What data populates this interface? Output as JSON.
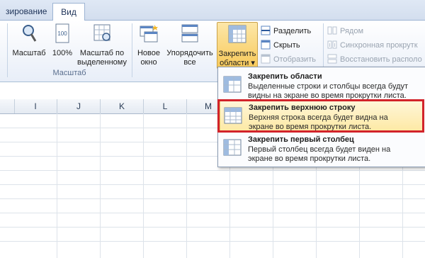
{
  "tabs": [
    {
      "label": "зирование"
    },
    {
      "label": "Вид"
    }
  ],
  "ribbon": {
    "zoom_button": "Масштаб",
    "zoom100_button": "100%",
    "zoom_selection_line1": "Масштаб по",
    "zoom_selection_line2": "выделенному",
    "zoom_group_label": "Масштаб",
    "new_window_line1": "Новое",
    "new_window_line2": "окно",
    "arrange_line1": "Упорядочить",
    "arrange_line2": "все",
    "freeze_line1": "Закрепить",
    "freeze_line2": "области",
    "freeze_arrow": "▾",
    "split": "Разделить",
    "hide": "Скрыть",
    "unhide": "Отобразить",
    "side_by_side": "Рядом",
    "sync_scroll": "Синхронная прокрутк",
    "reset_position": "Восстановить располо"
  },
  "columns": [
    "I",
    "J",
    "K",
    "L",
    "M"
  ],
  "freeze_menu": {
    "items": [
      {
        "title": "Закрепить области",
        "desc_line1": "Выделенные строки и столбцы всегда будут",
        "desc_line2": "видны на экране во время прокрутки листа."
      },
      {
        "title": "Закрепить верхнюю строку",
        "desc_line1": "Верхняя строка всегда будет видна на",
        "desc_line2": "экране во время прокрутки листа."
      },
      {
        "title": "Закрепить первый столбец",
        "desc_line1": "Первый столбец всегда будет виден на",
        "desc_line2": "экране во время прокрутки листа."
      }
    ]
  },
  "colors": {
    "highlight_frame": "#d2232a",
    "menu_highlight": "#fde9a4",
    "accent": "#2b579a"
  }
}
